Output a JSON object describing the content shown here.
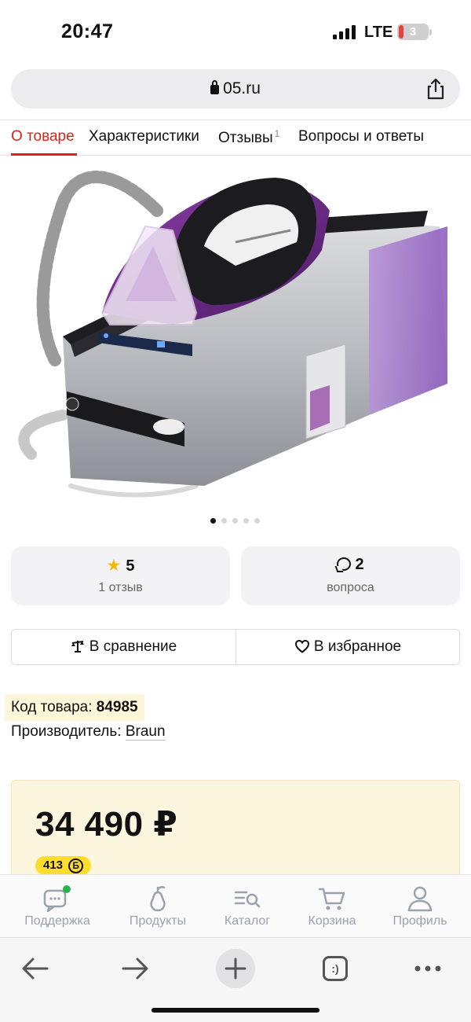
{
  "status_bar": {
    "time": "20:47",
    "network": "LTE",
    "battery": "3"
  },
  "browser": {
    "url": "05.ru"
  },
  "tabs": [
    {
      "label": "О товаре",
      "active": true
    },
    {
      "label": "Характеристики",
      "active": false
    },
    {
      "label": "Отзывы",
      "count": "1",
      "active": false
    },
    {
      "label": "Вопросы и ответы",
      "active": false
    }
  ],
  "gallery": {
    "total_images": 5,
    "current_index": 1
  },
  "rating_card": {
    "value": "5",
    "subtitle": "1 отзыв",
    "icon": "star-icon"
  },
  "questions_card": {
    "value": "2",
    "subtitle": "вопроса",
    "icon": "chat-bubble-icon"
  },
  "actions": {
    "compare_label": "В сравнение",
    "favorite_label": "В избранное"
  },
  "product_info": {
    "sku_label": "Код товара:",
    "sku_value": "84985",
    "maker_label": "Производитель:",
    "maker_value": "Braun"
  },
  "pricing": {
    "price": "34 490 ₽",
    "bonus": "413",
    "bonus_symbol": "Б"
  },
  "app_nav": [
    {
      "label": "Поддержка",
      "icon": "support-chat-icon"
    },
    {
      "label": "Продукты",
      "icon": "pear-icon"
    },
    {
      "label": "Каталог",
      "icon": "catalog-search-icon"
    },
    {
      "label": "Корзина",
      "icon": "cart-icon"
    },
    {
      "label": "Профиль",
      "icon": "profile-icon"
    }
  ],
  "browser_toolbar": {
    "tabs_symbol": ":)"
  },
  "colors": {
    "accent": "#e0201a",
    "price_bg": "#fdf6df",
    "bonus_bg": "#ffdd2d",
    "nav_gray": "#9aa3ad",
    "notification": "#2bb24c"
  }
}
